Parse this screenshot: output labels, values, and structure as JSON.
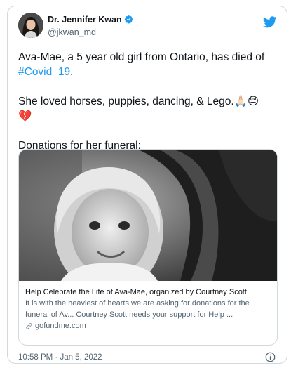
{
  "author": {
    "name": "Dr. Jennifer Kwan",
    "handle": "@jkwan_md"
  },
  "tweet": {
    "line1": "Ava-Mae, a 5 year old girl from Ontario, has died of",
    "hashtag": "#Covid_19",
    "line1_end": ".",
    "line2": "She loved horses, puppies, dancing, & Lego.🙏🏻😔",
    "line2_emoji": "💔",
    "line3": "Donations for her funeral:"
  },
  "link_card": {
    "title": "Help Celebrate the Life of Ava-Mae, organized by Courtney Scott",
    "description": "It is with the heaviest of hearts we are asking for donations for the funeral of Av... Courtney Scott needs your support for Help ...",
    "domain": "gofundme.com"
  },
  "footer": {
    "timestamp": "10:58 PM · Jan 5, 2022"
  },
  "colors": {
    "link_blue": "#1d9bf0",
    "muted": "#536471",
    "border": "#cfd9de"
  },
  "icons": [
    "verified-badge-icon",
    "twitter-bird-icon",
    "link-icon",
    "info-icon"
  ]
}
